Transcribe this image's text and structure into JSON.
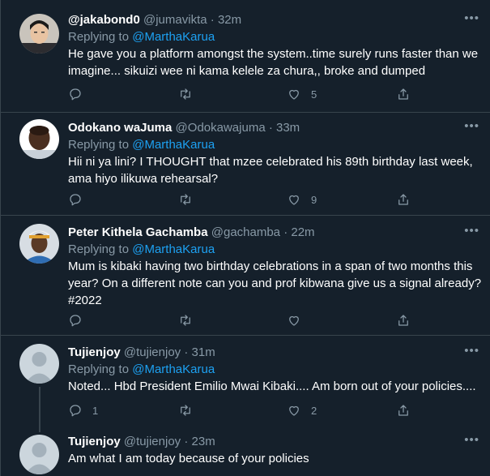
{
  "ui": {
    "more_glyph": "•••",
    "replying_prefix": "Replying to ",
    "separator": "·"
  },
  "icons": {
    "reply": "reply-icon",
    "retweet": "retweet-icon",
    "like": "heart-icon",
    "share": "share-icon",
    "more": "more-options-icon"
  },
  "colors": {
    "background": "#15202b",
    "border": "#38444d",
    "secondary_text": "#8899a6",
    "link": "#1da1f2"
  },
  "tweets": [
    {
      "name": "@jakabond0",
      "handle": "@jumavikta",
      "time": "32m",
      "replying_to": "@MarthaKarua",
      "lines": [
        "He gave you a platform amongst the system..time surely runs faster than we",
        "imagine... sikuizi wee ni kama kelele za chura,, broke and dumped"
      ],
      "replies": "",
      "retweets": "",
      "likes": "5"
    },
    {
      "name": "Odokano waJuma",
      "handle": "@Odokawajuma",
      "time": "33m",
      "replying_to": "@MarthaKarua",
      "lines": [
        "Hii ni ya lini? I THOUGHT that mzee celebrated his 89th birthday last week,",
        "ama hiyo ilikuwa rehearsal?"
      ],
      "replies": "",
      "retweets": "",
      "likes": "9"
    },
    {
      "name": "Peter Kithela Gachamba",
      "handle": "@gachamba",
      "time": "22m",
      "replying_to": "@MarthaKarua",
      "lines": [
        "Mum is kibaki having two birthday celebrations in a span of two months this",
        "year? On a different note can you and prof kibwana give us a signal already?",
        "#2022"
      ],
      "replies": "",
      "retweets": "",
      "likes": ""
    },
    {
      "name": "Tujienjoy",
      "handle": "@tujienjoy",
      "time": "31m",
      "replying_to": "@MarthaKarua",
      "lines": [
        "Noted... Hbd President Emilio Mwai Kibaki.... Am born out of your policies...."
      ],
      "replies": "1",
      "retweets": "",
      "likes": "2"
    },
    {
      "name": "Tujienjoy",
      "handle": "@tujienjoy",
      "time": "23m",
      "lines": [
        "Am what I am today because of your policies"
      ]
    }
  ]
}
